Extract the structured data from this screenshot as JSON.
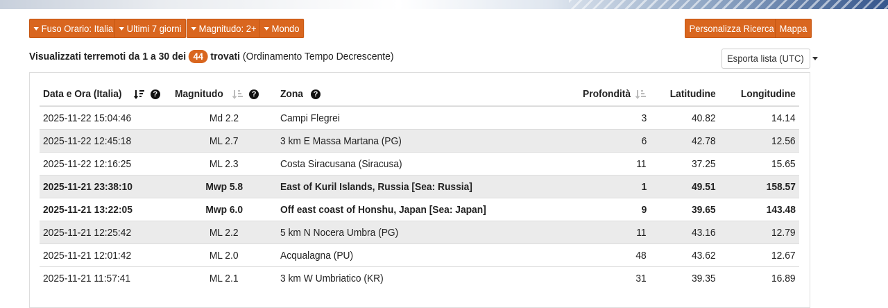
{
  "filters": {
    "timezone": "Fuso Orario: Italia",
    "period": "Ultimi 7 giorni",
    "magnitude": "Magnitudo: 2+",
    "region": "Mondo",
    "customize": "Personalizza Ricerca",
    "map": "Mappa"
  },
  "summary": {
    "prefix": "Visualizzati terremoti da 1 a 30 dei",
    "count": "44",
    "found": "trovati",
    "order": "(Ordinamento Tempo Decrescente)"
  },
  "export": {
    "label": "Esporta lista (UTC)"
  },
  "table": {
    "headers": {
      "datetime": "Data e Ora (Italia)",
      "magnitude": "Magnitudo",
      "zone": "Zona",
      "depth": "Profondità",
      "latitude": "Latitudine",
      "longitude": "Longitudine"
    },
    "rows": [
      {
        "datetime": "2025-11-22 15:04:46",
        "mag": "Md 2.2",
        "zone": "Campi Flegrei",
        "depth": "3",
        "lat": "40.82",
        "lon": "14.14"
      },
      {
        "datetime": "2025-11-22 12:45:18",
        "mag": "ML 2.7",
        "zone": "3 km E Massa Martana (PG)",
        "depth": "6",
        "lat": "42.78",
        "lon": "12.56"
      },
      {
        "datetime": "2025-11-22 12:16:25",
        "mag": "ML 2.3",
        "zone": "Costa Siracusana (Siracusa)",
        "depth": "11",
        "lat": "37.25",
        "lon": "15.65"
      },
      {
        "datetime": "2025-11-21 23:38:10",
        "mag": "Mwp 5.8",
        "zone": "East of Kuril Islands, Russia [Sea: Russia]",
        "depth": "1",
        "lat": "49.51",
        "lon": "158.57"
      },
      {
        "datetime": "2025-11-21 13:22:05",
        "mag": "Mwp 6.0",
        "zone": "Off east coast of Honshu, Japan [Sea: Japan]",
        "depth": "9",
        "lat": "39.65",
        "lon": "143.48"
      },
      {
        "datetime": "2025-11-21 12:25:42",
        "mag": "ML 2.2",
        "zone": "5 km N Nocera Umbra (PG)",
        "depth": "11",
        "lat": "43.16",
        "lon": "12.79"
      },
      {
        "datetime": "2025-11-21 12:01:42",
        "mag": "ML 2.0",
        "zone": "Acqualagna (PU)",
        "depth": "48",
        "lat": "43.62",
        "lon": "12.67"
      },
      {
        "datetime": "2025-11-21 11:57:41",
        "mag": "ML 2.1",
        "zone": "3 km W Umbriatico (KR)",
        "depth": "31",
        "lat": "39.35",
        "lon": "16.89"
      }
    ]
  },
  "colors": {
    "accent": "#d9661f",
    "row_alt": "#ebebeb",
    "border": "#dddddd"
  }
}
